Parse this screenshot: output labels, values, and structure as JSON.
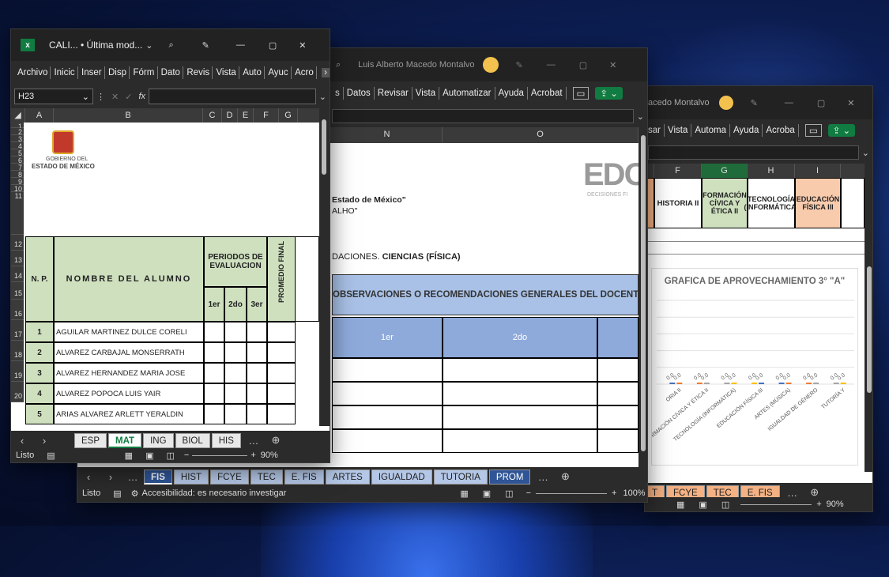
{
  "win_left": {
    "excel_icon": "x",
    "title": "CALI... • Última mod...",
    "ribbon_tabs": [
      "Archivo",
      "Inicic",
      "Inser",
      "Disp",
      "Fórm",
      "Dato",
      "Revis",
      "Vista",
      "Auto",
      "Ayuc",
      "Acro"
    ],
    "name_box": "H23",
    "fx": "fx",
    "col_headers": [
      "A",
      "B",
      "C",
      "D",
      "E",
      "F",
      "G"
    ],
    "rows": [
      "1",
      "2",
      "3",
      "4",
      "5",
      "6",
      "7",
      "8",
      "9",
      "10",
      "11",
      "12",
      "13",
      "14",
      "15",
      "16",
      "17",
      "18",
      "19",
      "20"
    ],
    "logo_line1": "GOBIERNO DEL",
    "logo_line2": "ESTADO DE MÉXICO",
    "hdr_np": "N. P.",
    "hdr_nombre": "NOMBRE DEL ALUMNO",
    "hdr_periodos": "PERIODOS DE EVALUACION",
    "hdr_promedio": "PROMEDIO FINAL",
    "periods": [
      "1er",
      "2do",
      "3er"
    ],
    "students": [
      {
        "n": "1",
        "name": "AGUILAR MARTINEZ DULCE CORELI"
      },
      {
        "n": "2",
        "name": "ALVAREZ CARBAJAL MONSERRATH"
      },
      {
        "n": "3",
        "name": "ALVAREZ HERNANDEZ MARIA JOSE"
      },
      {
        "n": "4",
        "name": "ALVAREZ POPOCA LUIS YAIR"
      },
      {
        "n": "5",
        "name": "ARIAS ALVAREZ ARLETT YERALDIN"
      }
    ],
    "sheet_tabs": [
      "ESP",
      "MAT",
      "ING",
      "BIOL",
      "HIS"
    ],
    "status": "Listo",
    "zoom": "90%"
  },
  "win_mid": {
    "user": "Luis Alberto Macedo Montalvo",
    "ribbon_tabs": [
      "s",
      "Datos",
      "Revisar",
      "Vista",
      "Automatizar",
      "Ayuda",
      "Acrobat"
    ],
    "col_n": "N",
    "col_o": "O",
    "text_estado": "Estado de México\"",
    "text_alho": "ALHO\"",
    "logo": "EDO",
    "logo_sub": "DECISIONES FI",
    "recomendaciones_prefix": "DACIONES.",
    "recomendaciones_bold": "CIENCIAS (FÍSICA)",
    "observaciones": "OBSERVACIONES O RECOMENDACIONES GENERALES DEL DOCENTE",
    "p1": "1er",
    "p2": "2do",
    "sheet_tabs": [
      "FIS",
      "HIST",
      "FCYE",
      "TEC",
      "E. FIS",
      "ARTES",
      "IGUALDAD",
      "TUTORIA",
      "PROM"
    ],
    "status": "Listo",
    "accessibility": "Accesibilidad: es necesario investigar",
    "zoom": "100%"
  },
  "win_right": {
    "user": "acedo Montalvo",
    "ribbon_tabs": [
      "sar",
      "Vista",
      "Automa",
      "Ayuda",
      "Acroba"
    ],
    "col_headers": [
      "F",
      "G",
      "H",
      "I"
    ],
    "subjects": [
      "HISTORIA II",
      "FORMACIÓN CÍVICA Y ÉTICA II",
      "TECNOLOGÍA (INFORMÁTICA)",
      "EDUCACIÓN FÍSICA III"
    ],
    "chart_title": "GRAFICA DE APROVECHAMIENTO 3° \"A\"",
    "sheet_tabs": [
      "T",
      "FCYE",
      "TEC",
      "E. FIS"
    ],
    "zoom": "90%"
  },
  "chart_data": {
    "type": "bar",
    "title": "GRAFICA DE APROVECHAMIENTO 3° \"A\"",
    "categories": [
      "ORIA II",
      "FORMACIÓN CÍVICA Y ÉTICA II",
      "TECNOLOGÍA (INFORMÁTICA)",
      "EDUCACIÓN FÍSICA III",
      "ARTES (MÚSICA)",
      "IGUALDAD DE GÉNERO",
      "TUTORÍA Y"
    ],
    "series": [
      {
        "values": [
          0.0,
          0.0,
          0.0,
          0.0,
          0.0,
          0.0,
          0.0
        ]
      },
      {
        "values": [
          0.0,
          0.0,
          0.0,
          0.0,
          0.0,
          0.0,
          0.0
        ]
      }
    ],
    "series_colors": [
      "#4472c4",
      "#ed7d31",
      "#a5a5a5",
      "#ffc000"
    ],
    "ylim": [
      0,
      10
    ]
  }
}
